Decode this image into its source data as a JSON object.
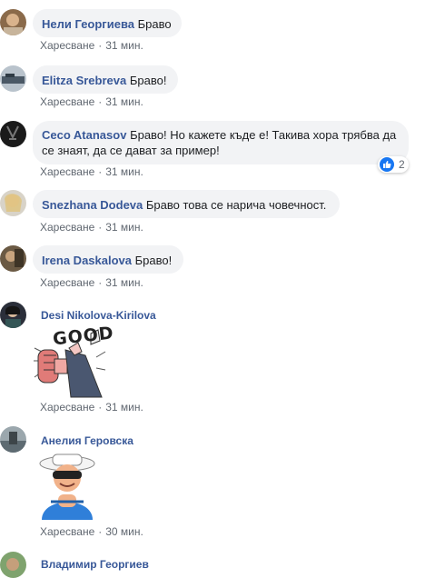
{
  "like_label": "Харесване",
  "comments": [
    {
      "author": "Нели Георгиева",
      "text": "Браво",
      "time": "31 мин."
    },
    {
      "author": "Elitza Srebreva",
      "text": "Браво!",
      "time": "31 мин."
    },
    {
      "author": "Ceco Atanasov",
      "text_line1": "Браво! Но кажете къде е! Такива хора трябва да",
      "text_line2": "се знаят, да се дават за пример!",
      "time": "31 мин.",
      "reactions": "2"
    },
    {
      "author": "Snezhana Dodeva",
      "text": "Браво това се нарича човечност.",
      "time": "31 мин."
    },
    {
      "author": "Irena Daskalova",
      "text": "Браво!",
      "time": "31 мин."
    },
    {
      "author": "Desi Nikolova-Kirilova",
      "sticker_text": "GOOD",
      "time": "31 мин."
    },
    {
      "author": "Анелия Геровска",
      "time": "30 мин."
    },
    {
      "author": "Владимир Георгиев"
    }
  ],
  "colors": {
    "link": "#385898",
    "bubble": "#f2f3f5",
    "meta": "#606770",
    "like_blue": "#1877f2"
  }
}
